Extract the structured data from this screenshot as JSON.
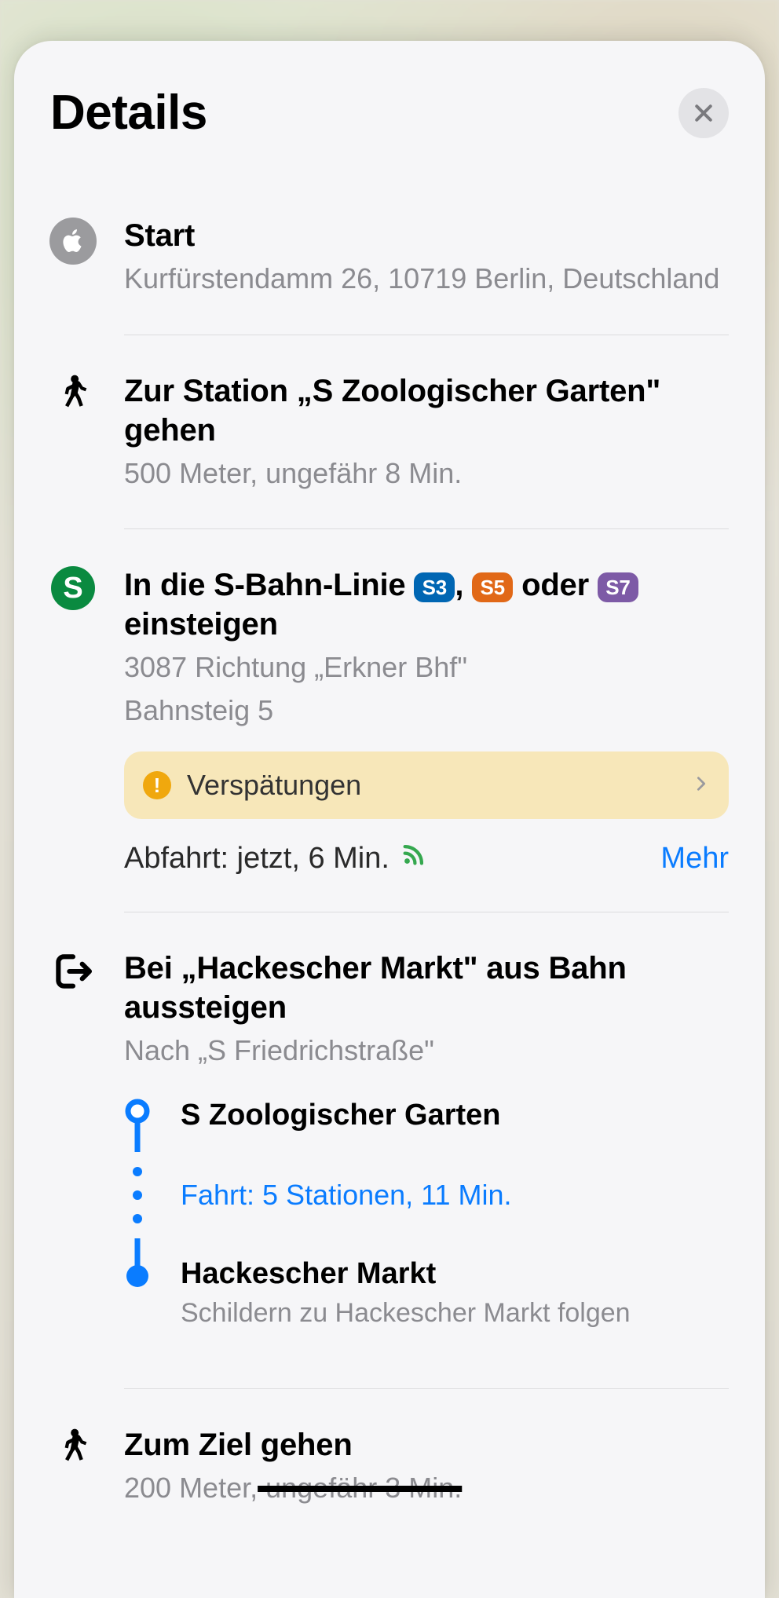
{
  "header": {
    "title": "Details"
  },
  "steps": {
    "start": {
      "title": "Start",
      "address": "Kurfürstendamm 26, 10719 Berlin, Deutschland"
    },
    "walk1": {
      "title": "Zur Station „S Zoologischer Garten\" gehen",
      "detail": "500 Meter, ungefähr 8 Min."
    },
    "board": {
      "title_pre": "In die S-Bahn-Linie ",
      "title_sep": ", ",
      "title_or": " oder ",
      "title_post": " einsteigen",
      "lines": {
        "s3": "S3",
        "s5": "S5",
        "s7": "S7"
      },
      "detail1": "3087 Richtung „Erkner Bhf\"",
      "detail2": "Bahnsteig 5",
      "advisory": "Verspätungen",
      "departure": "Abfahrt: jetzt, 6 Min.",
      "more": "Mehr"
    },
    "exit": {
      "title": "Bei „Hackescher Markt\" aus Bahn aussteigen",
      "detail": "Nach „S Friedrichstraße\"",
      "journey": {
        "from": "S Zoologischer Garten",
        "ride": "Fahrt: 5 Stationen, 11 Min.",
        "to": "Hackescher Markt",
        "to_sub": "Schildern zu Hackescher Markt folgen"
      }
    },
    "walk2": {
      "title": "Zum Ziel gehen",
      "detail_prefix": "200 Meter,",
      "detail_struck": " ungefähr 3 Min."
    }
  },
  "icons": {
    "sbahn_letter": "S"
  },
  "colors": {
    "accent_blue": "#0a7cff",
    "s3": "#0066b3",
    "s5": "#e16817",
    "s7": "#7d5aa6",
    "sbahn_green": "#0a8a40"
  }
}
